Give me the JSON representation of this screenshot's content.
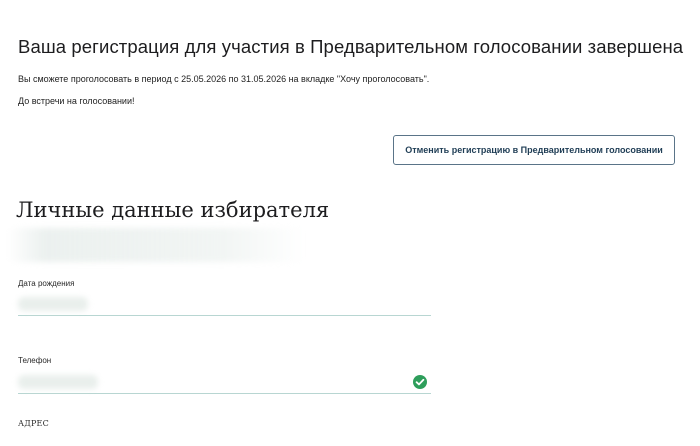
{
  "header": {
    "title": "Ваша регистрация для участия в Предварительном голосовании завершена",
    "info_line1": "Вы сможете проголосовать в период с 25.05.2026 по 31.05.2026 на вкладке \"Хочу проголосовать\".",
    "info_line2": "До встречи на голосовании!"
  },
  "actions": {
    "cancel_label": "Отменить регистрацию в Предварительном голосовании"
  },
  "voter": {
    "section_title": "Личные данные избирателя",
    "birth_label": "Дата рождения",
    "phone_label": "Телефон",
    "phone_verified_icon": "check-circle-icon",
    "address_label": "АДРЕС"
  },
  "colors": {
    "accent_border": "#5a7488",
    "success": "#2e9e5b",
    "field_underline": "#b8d6d2"
  }
}
